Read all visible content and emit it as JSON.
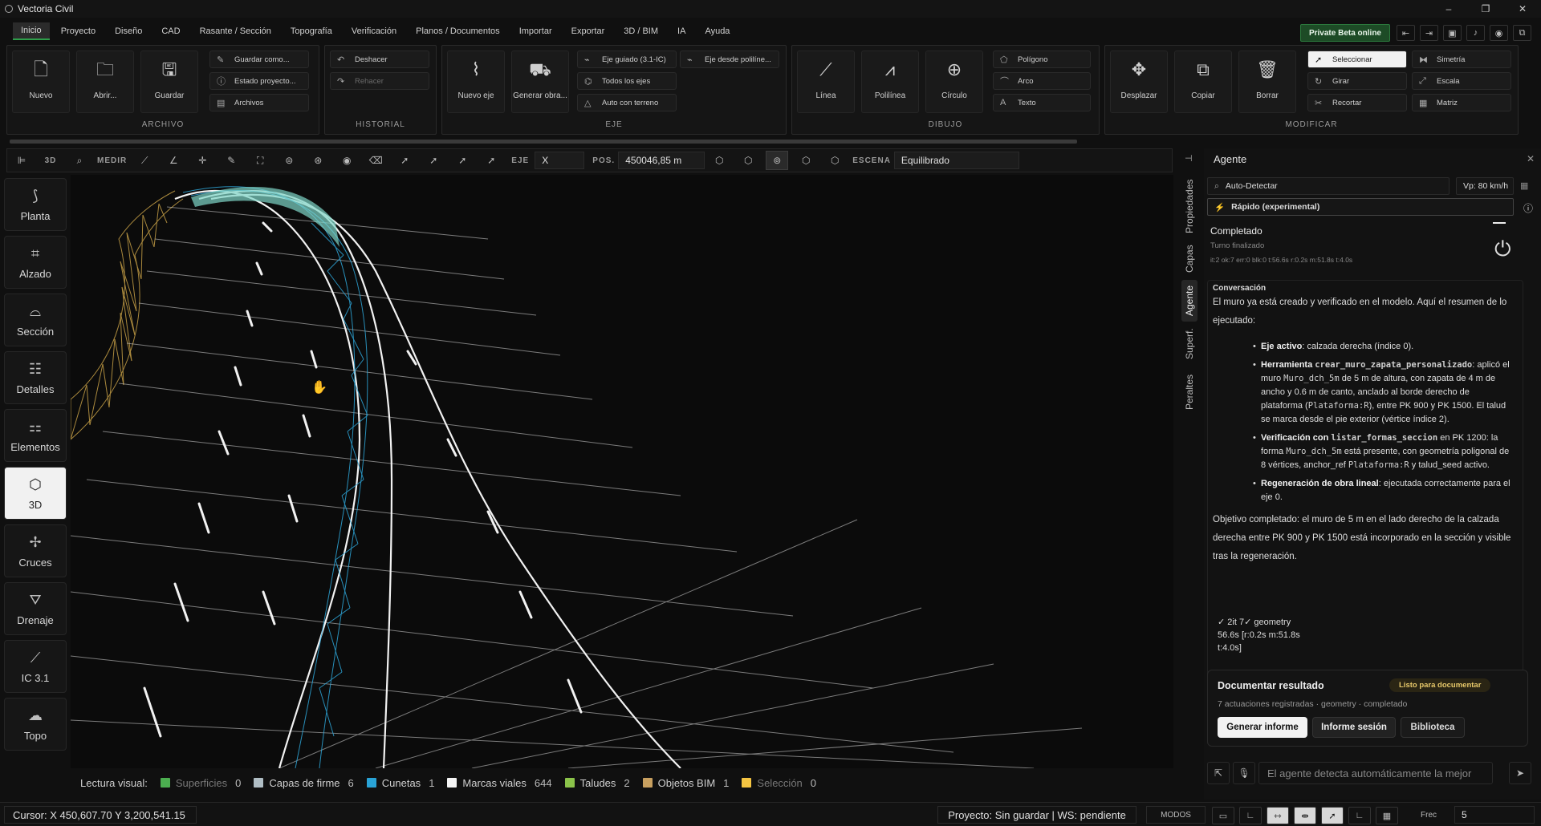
{
  "app": {
    "title": "Vectoria Civil"
  },
  "window_controls": [
    "–",
    "❐",
    "✕"
  ],
  "menu": [
    "Inicio",
    "Proyecto",
    "Diseño",
    "CAD",
    "Rasante / Sección",
    "Topografía",
    "Verificación",
    "Planos / Documentos",
    "Importar",
    "Exportar",
    "3D / BIM",
    "IA",
    "Ayuda"
  ],
  "beta_button": "Private Beta online",
  "ribbon": {
    "archivo": {
      "label": "ARCHIVO",
      "nuevo": "Nuevo",
      "abrir": "Abrir...",
      "guardar": "Guardar",
      "guardar_como": "Guardar como...",
      "estado": "Estado proyecto...",
      "archivos": "Archivos"
    },
    "historial": {
      "label": "HISTORIAL",
      "deshacer": "Deshacer",
      "rehacer": "Rehacer"
    },
    "eje": {
      "label": "EJE",
      "nuevo_eje": "Nuevo eje",
      "generar_obra": "Generar obra...",
      "eje_guiado": "Eje guiado (3.1-IC)",
      "eje_polilinea": "Eje desde polilíne...",
      "todos_ejes": "Todos los ejes",
      "auto_terreno": "Auto con terreno"
    },
    "dibujo": {
      "label": "DIBUJO",
      "linea": "Línea",
      "polilinea": "Polilínea",
      "circulo": "Círculo",
      "poligono": "Polígono",
      "arco": "Arco",
      "texto": "Texto"
    },
    "modificar": {
      "label": "MODIFICAR",
      "desplazar": "Desplazar",
      "copiar": "Copiar",
      "borrar": "Borrar",
      "seleccionar": "Seleccionar",
      "simetria": "Simetría",
      "girar": "Girar",
      "escala": "Escala",
      "recortar": "Recortar",
      "matriz": "Matriz"
    }
  },
  "toolbar": {
    "view_3d": "3D",
    "medir": "MEDIR",
    "eje_label": "EJE",
    "eje_value": "X",
    "pos_label": "POS.",
    "pos_value": "450046,85 m",
    "escena_label": "ESCENA",
    "escena_value": "Equilibrado"
  },
  "nav": [
    "Planta",
    "Alzado",
    "Sección",
    "Detalles",
    "Elementos",
    "3D",
    "Cruces",
    "Drenaje",
    "IC 3.1",
    "Topo"
  ],
  "nav_active": "3D",
  "legend": {
    "title": "Lectura visual:",
    "items": [
      {
        "label": "Superficies",
        "count": "0",
        "color": "#4caf50"
      },
      {
        "label": "Capas de firme",
        "count": "6",
        "color": "#b0bec5"
      },
      {
        "label": "Cunetas",
        "count": "1",
        "color": "#29a3d6"
      },
      {
        "label": "Marcas viales",
        "count": "644",
        "color": "#f5f5f5"
      },
      {
        "label": "Taludes",
        "count": "2",
        "color": "#8bc34a"
      },
      {
        "label": "Objetos BIM",
        "count": "1",
        "color": "#c8a060"
      },
      {
        "label": "Selección",
        "count": "0",
        "color": "#f5c542"
      }
    ]
  },
  "status": {
    "cursor": "Cursor: X 450,607.70  Y 3,200,541.15",
    "project": "Proyecto: Sin guardar | WS: pendiente",
    "modos": "MODOS",
    "frec_label": "Frec",
    "frec_value": "5"
  },
  "side_tabs": [
    "Propiedades",
    "Capas",
    "Agente",
    "Superf.",
    "Peraltes"
  ],
  "agent": {
    "title": "Agente",
    "detect": "Auto-Detectar",
    "vp": "Vp: 80 km/h",
    "mode": "Rápido (experimental)",
    "status_title": "Completado",
    "status_sub": "Turno finalizado",
    "status_metrics": "it:2 ok:7 err:0 blk:0 t:56.6s  r:0.2s m:51.8s t:4.0s",
    "conv_title": "Conversación",
    "intro": "El muro ya está creado y verificado en el modelo. Aquí el resumen de lo ejecutado:",
    "b1_head": "Eje activo",
    "b1_text": ": calzada derecha (índice 0).",
    "b2_head": "Herramienta",
    "b2_code": "crear_muro_zapata_personalizado",
    "b2_text1": ": aplicó el muro ",
    "b2_code2": "Muro_dch_5m",
    "b2_text2": " de 5 m de altura, con zapata de 4 m de ancho y 0.6 m de canto, anclado al borde derecho de plataforma (",
    "b2_code3": "Plataforma:R",
    "b2_text3": "), entre PK 900 y PK 1500. El talud se marca desde el pie exterior (vértice índice 2).",
    "b3_head": "Verificación con ",
    "b3_code": "listar_formas_seccion",
    "b3_text1": " en PK 1200: la forma ",
    "b3_code2": "Muro_dch_5m",
    "b3_text2": " está presente, con geometría poligonal de 8 vértices, anchor_ref ",
    "b3_code3": "Plataforma:R",
    "b3_text3": " y talud_seed activo.",
    "b4_head": "Regeneración de obra lineal",
    "b4_text": ": ejecutada correctamente para el eje 0.",
    "conclusion": "Objetivo completado: el muro de 5 m en el lado derecho de la calzada derecha entre PK 900 y PK 1500 está incorporado en la sección y visible tras la regeneración.",
    "metric1": "✓ 2it 7✓ geometry",
    "metric2": "56.6s [r:0.2s m:51.8s",
    "metric3": "t:4.0s]",
    "doc_title": "Documentar resultado",
    "doc_badge": "Listo para documentar",
    "doc_sub": "7 actuaciones registradas · geometry · completado",
    "btn_informe": "Generar informe",
    "btn_sesion": "Informe sesión",
    "btn_biblioteca": "Biblioteca",
    "input_placeholder": "El agente detecta automáticamente la mejor"
  }
}
